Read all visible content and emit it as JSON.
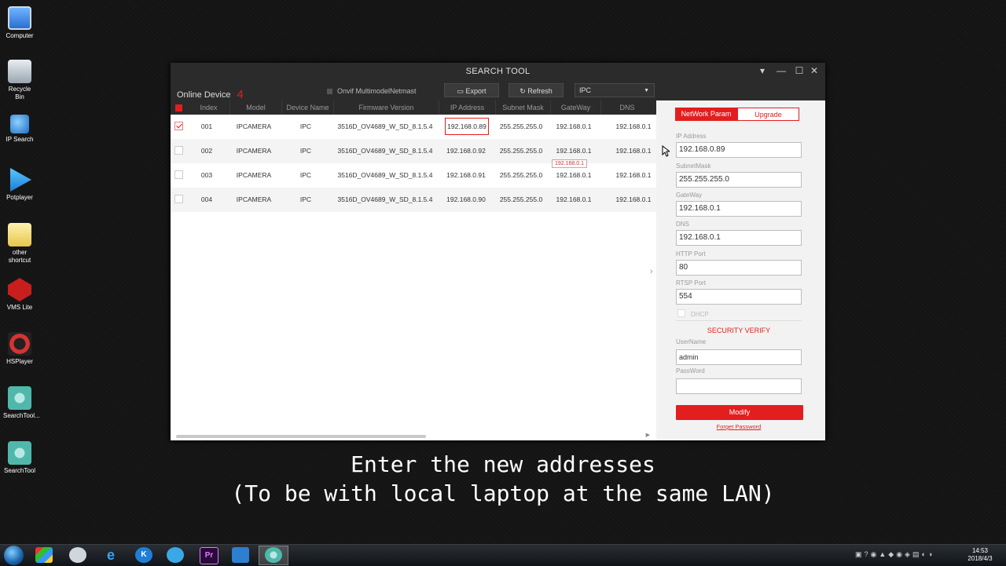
{
  "desktop": {
    "icons": [
      {
        "label": "Computer",
        "icon": "computer-icon"
      },
      {
        "label": "Recycle Bin",
        "icon": "recycle-bin-icon"
      },
      {
        "label": "IP Search",
        "icon": "ip-search-icon"
      },
      {
        "label": "Potplayer",
        "icon": "potplayer-icon"
      },
      {
        "label": "other shortcut",
        "icon": "folder-icon"
      },
      {
        "label": "VMS Lite",
        "icon": "vms-lite-icon"
      },
      {
        "label": "HSPlayer",
        "icon": "hsplayer-icon"
      },
      {
        "label": "SearchTool...",
        "icon": "searchtool-icon"
      },
      {
        "label": "SearchTool",
        "icon": "searchtool-icon"
      }
    ]
  },
  "window": {
    "title": "SEARCH TOOL",
    "controls": {
      "menu": "▾",
      "minimize": "—",
      "maximize": "☐",
      "close": "✕"
    }
  },
  "toolbar": {
    "online_label": "Online Device",
    "online_count": "4",
    "onvif_label": "Onvif MultimodelNetmast",
    "export_label": "Export",
    "refresh_label": "Refresh",
    "device_type": "IPC"
  },
  "table": {
    "columns": [
      "Index",
      "Model",
      "Device Name",
      "Firmware Version",
      "IP Address",
      "Subnet Mask",
      "GateWay",
      "DNS"
    ],
    "rows": [
      {
        "checked": true,
        "index": "001",
        "model": "IPCAMERA",
        "name": "IPC",
        "firmware": "3516D_OV4689_W_SD_8.1.5.4",
        "ip": "192.168.0.89",
        "mask": "255.255.255.0",
        "gateway": "192.168.0.1",
        "dns": "192.168.0.1"
      },
      {
        "checked": false,
        "index": "002",
        "model": "IPCAMERA",
        "name": "IPC",
        "firmware": "3516D_OV4689_W_SD_8.1.5.4",
        "ip": "192.168.0.92",
        "mask": "255.255.255.0",
        "gateway": "192.168.0.1",
        "dns": "192.168.0.1"
      },
      {
        "checked": false,
        "index": "003",
        "model": "IPCAMERA",
        "name": "IPC",
        "firmware": "3516D_OV4689_W_SD_8.1.5.4",
        "ip": "192.168.0.91",
        "mask": "255.255.255.0",
        "gateway": "192.168.0.1",
        "dns": "192.168.0.1"
      },
      {
        "checked": false,
        "index": "004",
        "model": "IPCAMERA",
        "name": "IPC",
        "firmware": "3516D_OV4689_W_SD_8.1.5.4",
        "ip": "192.168.0.90",
        "mask": "255.255.255.0",
        "gateway": "192.168.0.1",
        "dns": "192.168.0.1"
      }
    ],
    "tooltip": "192.168.0.1"
  },
  "panel": {
    "tab_network": "NetWork Param",
    "tab_upgrade": "Upgrade",
    "ip_label": "IP Address",
    "ip_value": "192.168.0.89",
    "mask_label": "SubnetMask",
    "mask_value": "255.255.255.0",
    "gateway_label": "GateWay",
    "gateway_value": "192.168.0.1",
    "dns_label": "DNS",
    "dns_value": "192.168.0.1",
    "http_label": "HTTP Port",
    "http_value": "80",
    "rtsp_label": "RTSP Port",
    "rtsp_value": "554",
    "dhcp_label": "DHCP",
    "security_heading": "SECURITY VERIFY",
    "user_label": "UserName",
    "user_value": "admin",
    "pass_label": "PassWord",
    "pass_value": "",
    "modify_label": "Modify",
    "forgot_label": "Forget Password"
  },
  "subtitle": {
    "line1": "Enter the new addresses",
    "line2": "(To be with local laptop at the same LAN)"
  },
  "taskbar": {
    "clock_time": "14:53",
    "clock_date": "2018/4/3"
  },
  "colors": {
    "accent": "#e31e1e",
    "window_bg": "#2b2b2b",
    "panel_bg": "#f2f2f2"
  }
}
